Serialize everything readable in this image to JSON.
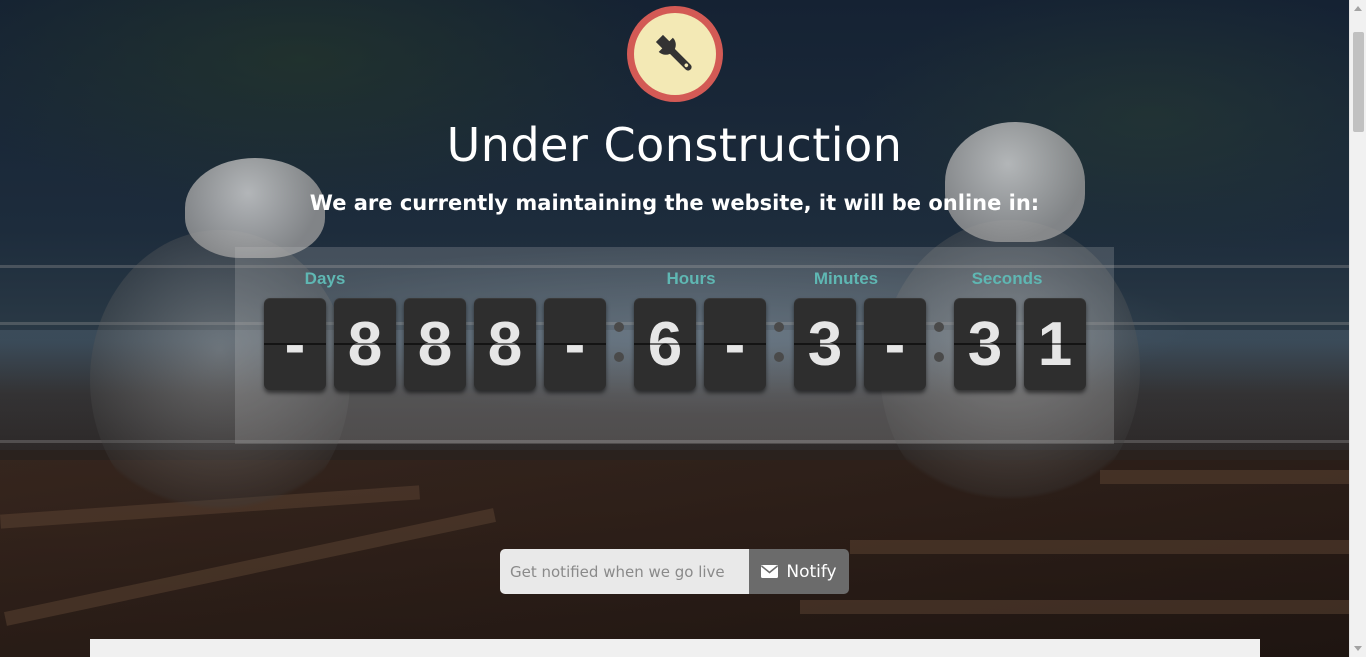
{
  "page": {
    "title": "Under Construction",
    "subtitle": "We are currently maintaining the website, it will be online in:",
    "logo_icon": "wrench-icon",
    "accent_color": "#d35a55",
    "label_color": "#5fb7b3"
  },
  "countdown": {
    "labels": {
      "days": "Days",
      "hours": "Hours",
      "minutes": "Minutes",
      "seconds": "Seconds"
    },
    "days_digits": [
      "-",
      "8",
      "8",
      "8",
      "-"
    ],
    "hours_digits": [
      "6",
      "-"
    ],
    "minutes_digits": [
      "3",
      "-"
    ],
    "seconds_digits": [
      "3",
      "1"
    ]
  },
  "notify": {
    "placeholder": "Get notified when we go live",
    "button_label": "Notify",
    "button_icon": "envelope-icon"
  }
}
